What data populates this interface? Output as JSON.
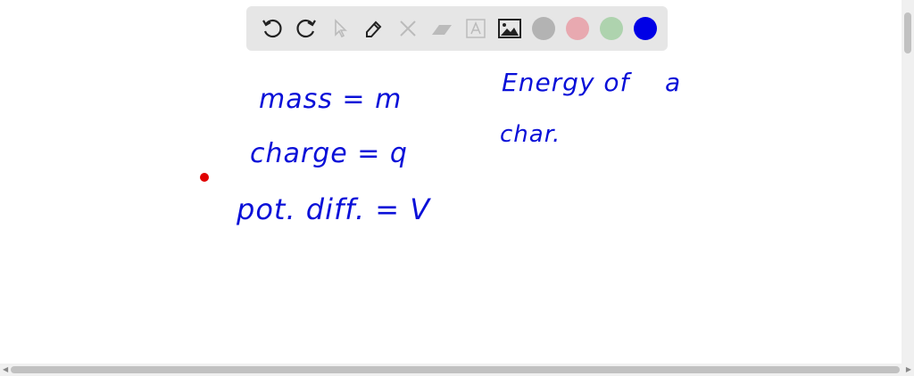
{
  "toolbar": {
    "tools": [
      "undo-icon",
      "redo-icon",
      "select-icon",
      "pen-icon",
      "tools-icon",
      "eraser-icon",
      "text-icon",
      "image-icon"
    ],
    "colors": [
      "#b3b3b3",
      "#e8a9b0",
      "#aed3ae",
      "#0000e6"
    ]
  },
  "canvas": {
    "lines": [
      "mass = m",
      "charge = q",
      "pot. diff. = V",
      "Energy of    a",
      "char."
    ],
    "pointer_color": "#e00000",
    "ink_color": "#0a10d8"
  }
}
